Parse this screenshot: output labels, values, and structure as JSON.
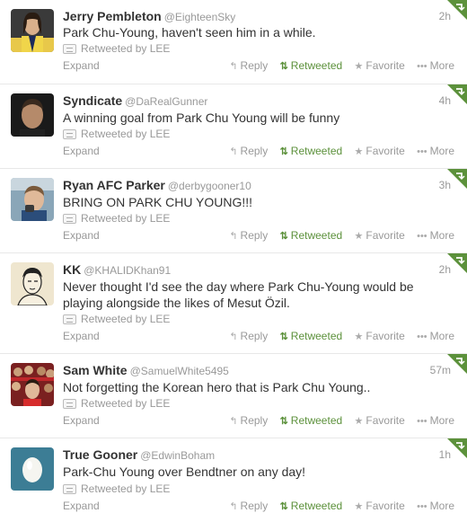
{
  "actions": {
    "expand": "Expand",
    "reply": "Reply",
    "retweeted": "Retweeted",
    "favorite": "Favorite",
    "more": "More"
  },
  "colors": {
    "retweet_green": "#5c913b",
    "muted": "#999999"
  },
  "tweets": [
    {
      "fullname": "Jerry Pembleton",
      "username": "@EighteenSky",
      "time": "2h",
      "text": "Park Chu-Young, haven't seen him in a while.",
      "context": "Retweeted by LEE"
    },
    {
      "fullname": "Syndicate",
      "username": "@DaRealGunner",
      "time": "4h",
      "text": "A winning goal from Park Chu Young will be funny",
      "context": "Retweeted by LEE"
    },
    {
      "fullname": "Ryan AFC Parker",
      "username": "@derbygooner10",
      "time": "3h",
      "text": "BRING ON PARK CHU YOUNG!!!",
      "context": "Retweeted by LEE"
    },
    {
      "fullname": "KK",
      "username": "@KHALIDKhan91",
      "time": "2h",
      "text": "Never thought I'd see the day where Park Chu-Young would be playing alongside the likes of Mesut Özil.",
      "context": "Retweeted by LEE"
    },
    {
      "fullname": "Sam White",
      "username": "@SamuelWhite5495",
      "time": "57m",
      "text": "Not forgetting the Korean hero that is Park Chu Young..",
      "context": "Retweeted by LEE"
    },
    {
      "fullname": "True Gooner",
      "username": "@EdwinBoham",
      "time": "1h",
      "text": "Park-Chu Young over Bendtner on any day!",
      "context": "Retweeted by LEE"
    }
  ]
}
